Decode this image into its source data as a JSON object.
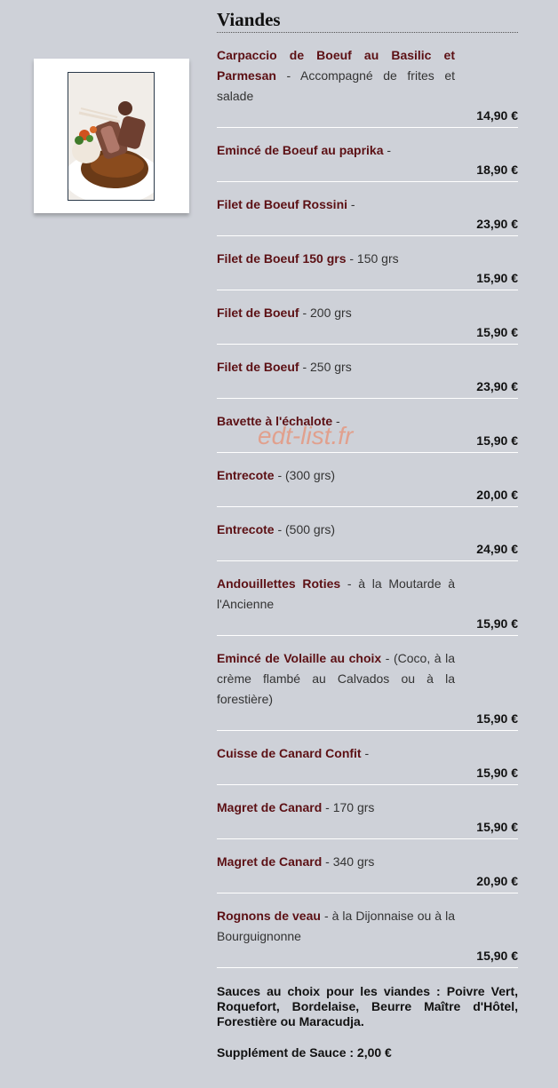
{
  "section": {
    "title": "Viandes"
  },
  "watermark": "edt-list.fr",
  "items": [
    {
      "name": "Carpaccio de Boeuf au Basilic et Parmesan",
      "detail": " - Accompagné de frites et salade",
      "price": "14,90 €"
    },
    {
      "name": "Emincé de Boeuf au paprika",
      "detail": " -",
      "price": "18,90 €"
    },
    {
      "name": "Filet de Boeuf Rossini",
      "detail": " -",
      "price": "23,90 €"
    },
    {
      "name": "Filet de Boeuf 150 grs",
      "detail": " - 150 grs",
      "price": "15,90 €"
    },
    {
      "name": "Filet de Boeuf",
      "detail": " - 200 grs",
      "price": "15,90 €"
    },
    {
      "name": "Filet de Boeuf",
      "detail": " - 250 grs",
      "price": "23,90 €"
    },
    {
      "name": "Bavette à l'échalote",
      "detail": " -",
      "price": "15,90 €"
    },
    {
      "name": "Entrecote",
      "detail": " - (300 grs)",
      "price": "20,00 €"
    },
    {
      "name": "Entrecote",
      "detail": " - (500 grs)",
      "price": "24,90 €"
    },
    {
      "name": "Andouillettes Roties",
      "detail": " - à la Moutarde à l'Ancienne",
      "price": "15,90 €"
    },
    {
      "name": "Emincé de Volaille au choix",
      "detail": " - (Coco, à la crème flambé au Calvados ou à la forestière)",
      "price": "15,90 €"
    },
    {
      "name": "Cuisse de Canard Confit",
      "detail": " -",
      "price": "15,90 €"
    },
    {
      "name": "Magret de Canard",
      "detail": " - 170 grs",
      "price": "15,90 €"
    },
    {
      "name": "Magret de Canard",
      "detail": " - 340 grs",
      "price": "20,90 €"
    },
    {
      "name": "Rognons de veau",
      "detail": " - à la Dijonnaise ou à la Bourguignonne",
      "price": "15,90 €"
    }
  ],
  "sauces": "Sauces au choix pour les viandes : Poivre Vert, Roquefort, Bordelaise, Beurre Maître d'Hôtel, Forestière ou Maracudja.",
  "supplement": "Supplément de Sauce  : 2,00 €"
}
